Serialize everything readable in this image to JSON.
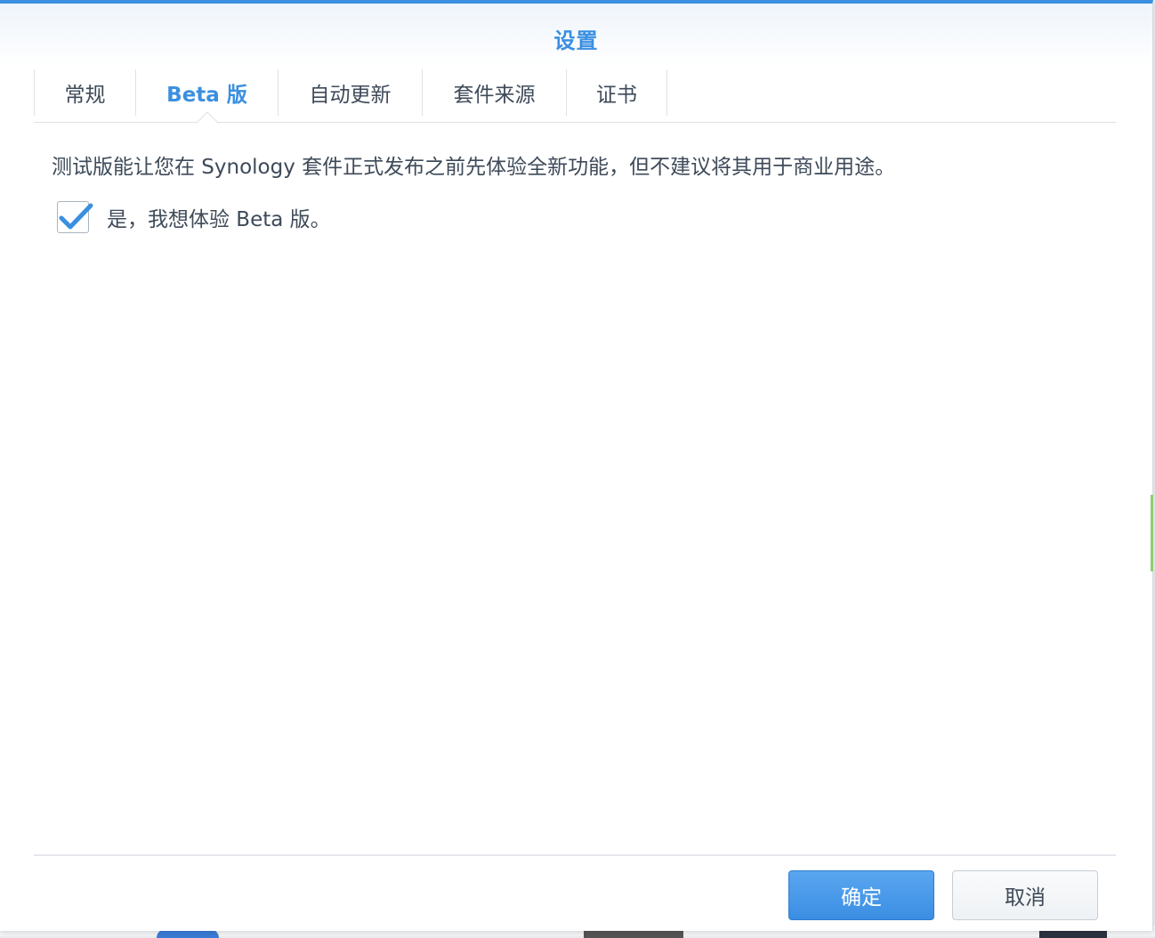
{
  "dialog": {
    "title": "设置"
  },
  "tabs": [
    {
      "label": "常规",
      "active": false
    },
    {
      "label": "Beta 版",
      "active": true
    },
    {
      "label": "自动更新",
      "active": false
    },
    {
      "label": "套件来源",
      "active": false
    },
    {
      "label": "证书",
      "active": false
    }
  ],
  "beta": {
    "description": "测试版能让您在 Synology 套件正式发布之前先体验全新功能，但不建议将其用于商业用途。",
    "checkbox_label": "是，我想体验 Beta 版。",
    "checked": true
  },
  "footer": {
    "ok_label": "确定",
    "cancel_label": "取消"
  },
  "colors": {
    "accent": "#3b8fe0",
    "text": "#3e4a59"
  }
}
